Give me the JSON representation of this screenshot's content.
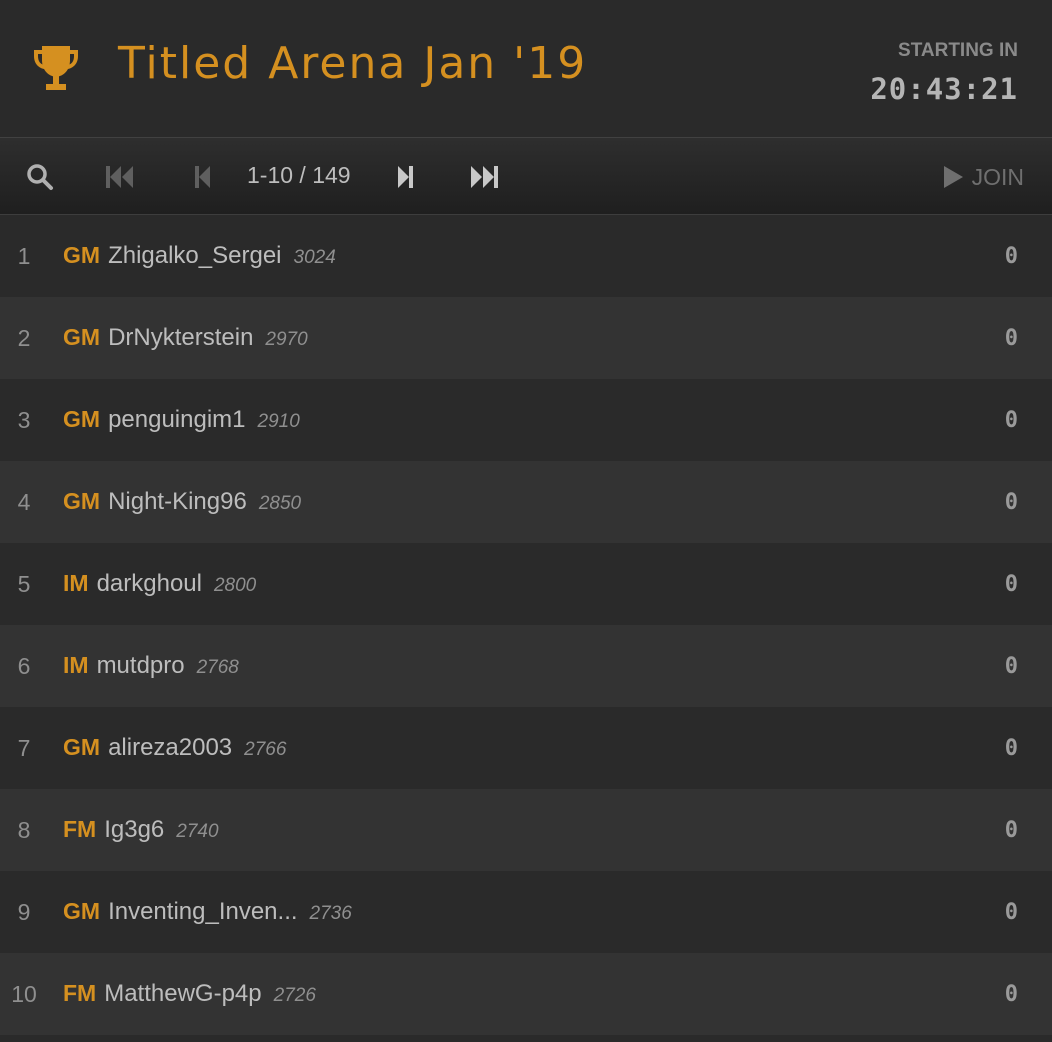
{
  "header": {
    "title": "Titled Arena Jan '19",
    "trophy_icon": "trophy-icon",
    "starting_label": "STARTING IN",
    "countdown": "20:43:21",
    "accent_color": "#d59020"
  },
  "pager": {
    "range": "1-10 / 149",
    "join_label": "JOIN",
    "icons": [
      "search-icon",
      "first-page-icon",
      "prev-page-icon",
      "next-page-icon",
      "last-page-icon",
      "play-icon"
    ]
  },
  "standings": [
    {
      "rank": "1",
      "title": "GM",
      "name": "Zhigalko_Sergei",
      "rating": "3024",
      "score": "0"
    },
    {
      "rank": "2",
      "title": "GM",
      "name": "DrNykterstein",
      "rating": "2970",
      "score": "0"
    },
    {
      "rank": "3",
      "title": "GM",
      "name": "penguingim1",
      "rating": "2910",
      "score": "0"
    },
    {
      "rank": "4",
      "title": "GM",
      "name": "Night-King96",
      "rating": "2850",
      "score": "0"
    },
    {
      "rank": "5",
      "title": "IM",
      "name": "darkghoul",
      "rating": "2800",
      "score": "0"
    },
    {
      "rank": "6",
      "title": "IM",
      "name": "mutdpro",
      "rating": "2768",
      "score": "0"
    },
    {
      "rank": "7",
      "title": "GM",
      "name": "alireza2003",
      "rating": "2766",
      "score": "0"
    },
    {
      "rank": "8",
      "title": "FM",
      "name": "Ig3g6",
      "rating": "2740",
      "score": "0"
    },
    {
      "rank": "9",
      "title": "GM",
      "name": "Inventing_Inven...",
      "rating": "2736",
      "score": "0"
    },
    {
      "rank": "10",
      "title": "FM",
      "name": "MatthewG-p4p",
      "rating": "2726",
      "score": "0"
    }
  ]
}
